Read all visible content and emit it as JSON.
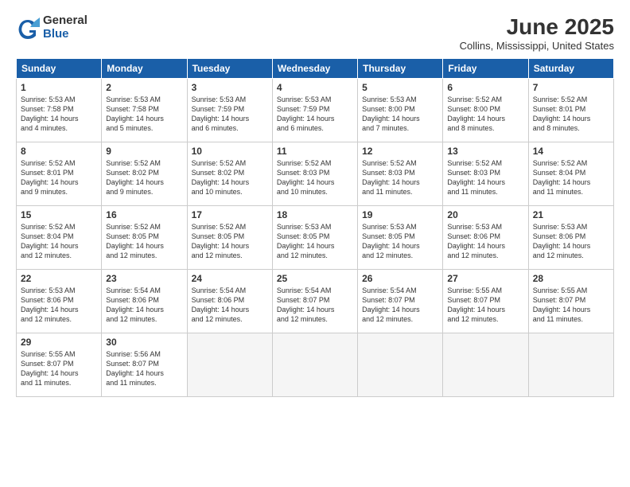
{
  "header": {
    "logo_general": "General",
    "logo_blue": "Blue",
    "month_year": "June 2025",
    "location": "Collins, Mississippi, United States"
  },
  "weekdays": [
    "Sunday",
    "Monday",
    "Tuesday",
    "Wednesday",
    "Thursday",
    "Friday",
    "Saturday"
  ],
  "rows": [
    [
      {
        "day": "1",
        "lines": [
          "Sunrise: 5:53 AM",
          "Sunset: 7:58 PM",
          "Daylight: 14 hours",
          "and 4 minutes."
        ]
      },
      {
        "day": "2",
        "lines": [
          "Sunrise: 5:53 AM",
          "Sunset: 7:58 PM",
          "Daylight: 14 hours",
          "and 5 minutes."
        ]
      },
      {
        "day": "3",
        "lines": [
          "Sunrise: 5:53 AM",
          "Sunset: 7:59 PM",
          "Daylight: 14 hours",
          "and 6 minutes."
        ]
      },
      {
        "day": "4",
        "lines": [
          "Sunrise: 5:53 AM",
          "Sunset: 7:59 PM",
          "Daylight: 14 hours",
          "and 6 minutes."
        ]
      },
      {
        "day": "5",
        "lines": [
          "Sunrise: 5:53 AM",
          "Sunset: 8:00 PM",
          "Daylight: 14 hours",
          "and 7 minutes."
        ]
      },
      {
        "day": "6",
        "lines": [
          "Sunrise: 5:52 AM",
          "Sunset: 8:00 PM",
          "Daylight: 14 hours",
          "and 8 minutes."
        ]
      },
      {
        "day": "7",
        "lines": [
          "Sunrise: 5:52 AM",
          "Sunset: 8:01 PM",
          "Daylight: 14 hours",
          "and 8 minutes."
        ]
      }
    ],
    [
      {
        "day": "8",
        "lines": [
          "Sunrise: 5:52 AM",
          "Sunset: 8:01 PM",
          "Daylight: 14 hours",
          "and 9 minutes."
        ]
      },
      {
        "day": "9",
        "lines": [
          "Sunrise: 5:52 AM",
          "Sunset: 8:02 PM",
          "Daylight: 14 hours",
          "and 9 minutes."
        ]
      },
      {
        "day": "10",
        "lines": [
          "Sunrise: 5:52 AM",
          "Sunset: 8:02 PM",
          "Daylight: 14 hours",
          "and 10 minutes."
        ]
      },
      {
        "day": "11",
        "lines": [
          "Sunrise: 5:52 AM",
          "Sunset: 8:03 PM",
          "Daylight: 14 hours",
          "and 10 minutes."
        ]
      },
      {
        "day": "12",
        "lines": [
          "Sunrise: 5:52 AM",
          "Sunset: 8:03 PM",
          "Daylight: 14 hours",
          "and 11 minutes."
        ]
      },
      {
        "day": "13",
        "lines": [
          "Sunrise: 5:52 AM",
          "Sunset: 8:03 PM",
          "Daylight: 14 hours",
          "and 11 minutes."
        ]
      },
      {
        "day": "14",
        "lines": [
          "Sunrise: 5:52 AM",
          "Sunset: 8:04 PM",
          "Daylight: 14 hours",
          "and 11 minutes."
        ]
      }
    ],
    [
      {
        "day": "15",
        "lines": [
          "Sunrise: 5:52 AM",
          "Sunset: 8:04 PM",
          "Daylight: 14 hours",
          "and 12 minutes."
        ]
      },
      {
        "day": "16",
        "lines": [
          "Sunrise: 5:52 AM",
          "Sunset: 8:05 PM",
          "Daylight: 14 hours",
          "and 12 minutes."
        ]
      },
      {
        "day": "17",
        "lines": [
          "Sunrise: 5:52 AM",
          "Sunset: 8:05 PM",
          "Daylight: 14 hours",
          "and 12 minutes."
        ]
      },
      {
        "day": "18",
        "lines": [
          "Sunrise: 5:53 AM",
          "Sunset: 8:05 PM",
          "Daylight: 14 hours",
          "and 12 minutes."
        ]
      },
      {
        "day": "19",
        "lines": [
          "Sunrise: 5:53 AM",
          "Sunset: 8:05 PM",
          "Daylight: 14 hours",
          "and 12 minutes."
        ]
      },
      {
        "day": "20",
        "lines": [
          "Sunrise: 5:53 AM",
          "Sunset: 8:06 PM",
          "Daylight: 14 hours",
          "and 12 minutes."
        ]
      },
      {
        "day": "21",
        "lines": [
          "Sunrise: 5:53 AM",
          "Sunset: 8:06 PM",
          "Daylight: 14 hours",
          "and 12 minutes."
        ]
      }
    ],
    [
      {
        "day": "22",
        "lines": [
          "Sunrise: 5:53 AM",
          "Sunset: 8:06 PM",
          "Daylight: 14 hours",
          "and 12 minutes."
        ]
      },
      {
        "day": "23",
        "lines": [
          "Sunrise: 5:54 AM",
          "Sunset: 8:06 PM",
          "Daylight: 14 hours",
          "and 12 minutes."
        ]
      },
      {
        "day": "24",
        "lines": [
          "Sunrise: 5:54 AM",
          "Sunset: 8:06 PM",
          "Daylight: 14 hours",
          "and 12 minutes."
        ]
      },
      {
        "day": "25",
        "lines": [
          "Sunrise: 5:54 AM",
          "Sunset: 8:07 PM",
          "Daylight: 14 hours",
          "and 12 minutes."
        ]
      },
      {
        "day": "26",
        "lines": [
          "Sunrise: 5:54 AM",
          "Sunset: 8:07 PM",
          "Daylight: 14 hours",
          "and 12 minutes."
        ]
      },
      {
        "day": "27",
        "lines": [
          "Sunrise: 5:55 AM",
          "Sunset: 8:07 PM",
          "Daylight: 14 hours",
          "and 12 minutes."
        ]
      },
      {
        "day": "28",
        "lines": [
          "Sunrise: 5:55 AM",
          "Sunset: 8:07 PM",
          "Daylight: 14 hours",
          "and 11 minutes."
        ]
      }
    ],
    [
      {
        "day": "29",
        "lines": [
          "Sunrise: 5:55 AM",
          "Sunset: 8:07 PM",
          "Daylight: 14 hours",
          "and 11 minutes."
        ]
      },
      {
        "day": "30",
        "lines": [
          "Sunrise: 5:56 AM",
          "Sunset: 8:07 PM",
          "Daylight: 14 hours",
          "and 11 minutes."
        ]
      },
      {
        "day": "",
        "lines": []
      },
      {
        "day": "",
        "lines": []
      },
      {
        "day": "",
        "lines": []
      },
      {
        "day": "",
        "lines": []
      },
      {
        "day": "",
        "lines": []
      }
    ]
  ]
}
